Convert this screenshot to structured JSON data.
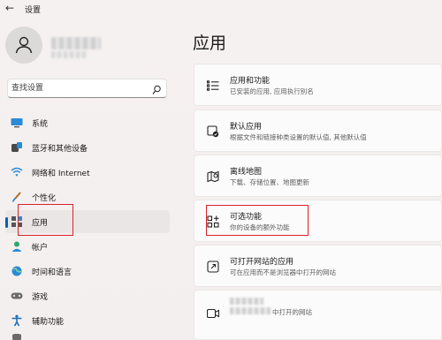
{
  "window": {
    "title": "设置"
  },
  "search": {
    "placeholder": "查找设置"
  },
  "sidebar": {
    "items": [
      {
        "label": "系统",
        "icon": "monitor-icon"
      },
      {
        "label": "蓝牙和其他设备",
        "icon": "bluetooth-icon"
      },
      {
        "label": "网络和 Internet",
        "icon": "wifi-icon"
      },
      {
        "label": "个性化",
        "icon": "brush-icon"
      },
      {
        "label": "应用",
        "icon": "apps-icon",
        "active": true
      },
      {
        "label": "帐户",
        "icon": "person-icon"
      },
      {
        "label": "时间和语言",
        "icon": "globe-icon"
      },
      {
        "label": "游戏",
        "icon": "gamepad-icon"
      },
      {
        "label": "辅助功能",
        "icon": "accessibility-icon"
      }
    ]
  },
  "main": {
    "title": "应用",
    "cards": [
      {
        "title": "应用和功能",
        "subtitle": "已安装的应用, 应用执行别名",
        "icon": "list-icon"
      },
      {
        "title": "默认应用",
        "subtitle": "根据文件和链接种类设置的默认值, 其他默认值",
        "icon": "default-app-icon"
      },
      {
        "title": "离线地图",
        "subtitle": "下载、存储位置、地图更新",
        "icon": "map-icon"
      },
      {
        "title": "可选功能",
        "subtitle": "你的设备的额外功能",
        "icon": "optional-features-icon"
      },
      {
        "title": "可打开网站的应用",
        "subtitle": "可在应用而不是浏览器中打开的网站",
        "icon": "open-link-icon"
      },
      {
        "title": "",
        "subtitle": "中打开的网站",
        "icon": "video-icon"
      }
    ]
  },
  "colors": {
    "accent": "#005fb8",
    "highlight_box": "#d8232a"
  }
}
